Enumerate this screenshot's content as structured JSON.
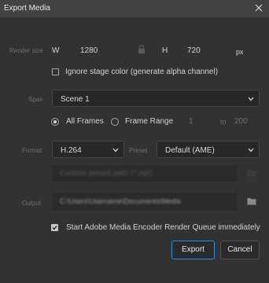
{
  "window": {
    "title": "Export Media"
  },
  "render_size": {
    "label": "Render size",
    "w_label": "W",
    "w_value": "1280",
    "h_label": "H",
    "h_value": "720",
    "unit": "px"
  },
  "ignore_stage_color": {
    "label": "Ignore stage color (generate alpha channel)",
    "checked": false
  },
  "span": {
    "label": "Span",
    "value": "Scene 1"
  },
  "frames": {
    "all_frames_label": "All Frames",
    "frame_range_label": "Frame Range",
    "selected": "all_frames",
    "range_from": "1",
    "range_to_label": "to",
    "range_to": "200"
  },
  "format": {
    "label": "Format",
    "value": "H.264"
  },
  "preset": {
    "label": "Preset",
    "value": "Default (AME)"
  },
  "custom_preset": {
    "placeholder": "Custom preset path (*.epr)"
  },
  "output": {
    "label": "Output",
    "path": "C:\\Users\\Username\\Documents\\Media"
  },
  "start_ame": {
    "label": "Start Adobe Media Encoder Render Queue immediately",
    "checked": true
  },
  "buttons": {
    "export": "Export",
    "cancel": "Cancel"
  },
  "colors": {
    "accent": "#2c8ee6",
    "background": "#323232"
  },
  "icons": [
    "close-icon",
    "lock-icon",
    "chevron-down-icon",
    "folder-icon",
    "checkmark-icon"
  ]
}
